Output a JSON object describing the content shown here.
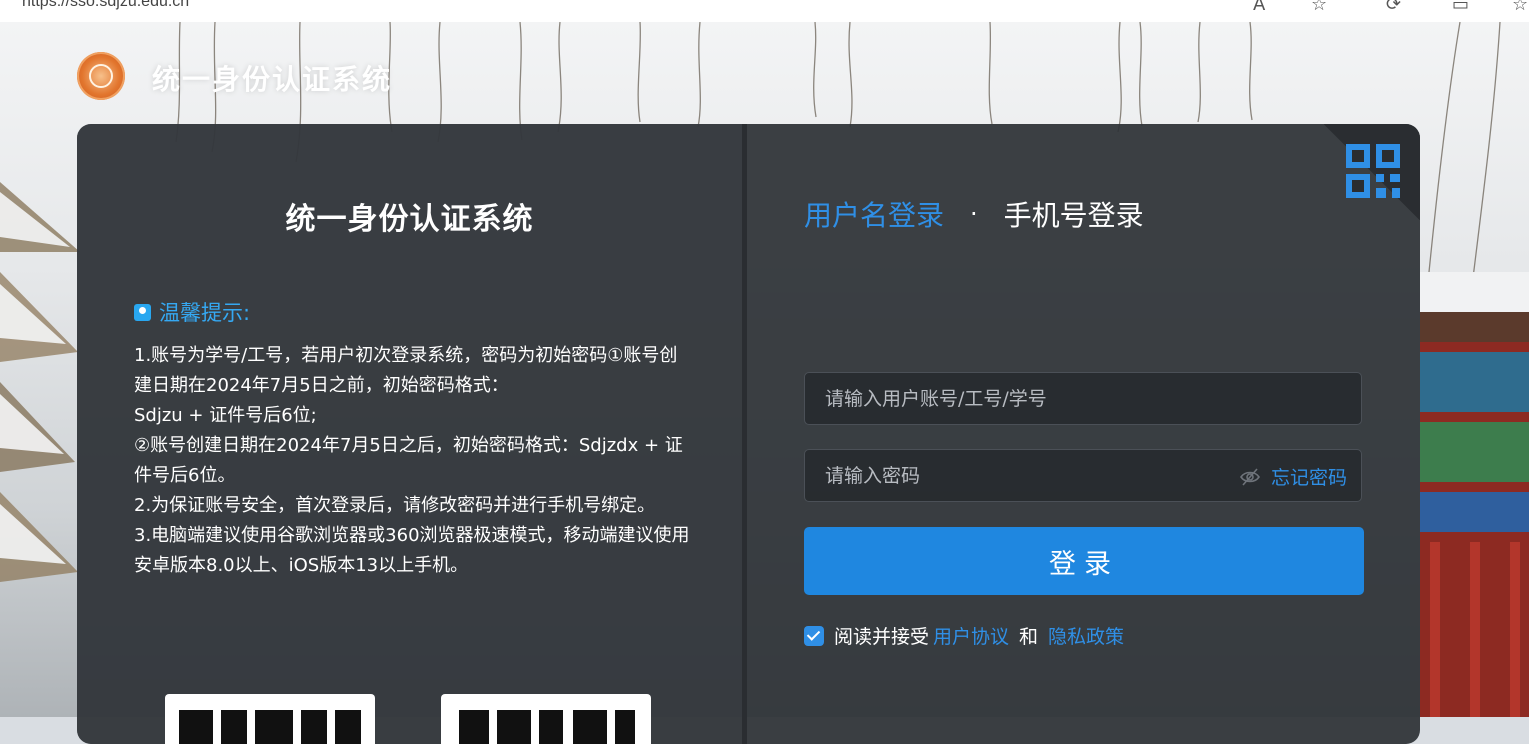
{
  "browser": {
    "url": "https://sso.sdjzu.edu.cn"
  },
  "header": {
    "title": "统一身份认证系统"
  },
  "left": {
    "title": "统一身份认证系统",
    "tips_title": "温馨提示:",
    "tips": [
      "1.账号为学号/工号，若用户初次登录系统，密码为初始密码①账号创建日期在2024年7月5日之前，初始密码格式：",
      "Sdjzu + 证件号后6位;",
      "②账号创建日期在2024年7月5日之后，初始密码格式：Sdjzdx + 证件号后6位。",
      "2.为保证账号安全，首次登录后，请修改密码并进行手机号绑定。",
      "3.电脑端建议使用谷歌浏览器或360浏览器极速模式，移动端建议使用安卓版本8.0以上、iOS版本13以上手机。"
    ]
  },
  "tabs": {
    "username_login": "用户名登录",
    "separator": "·",
    "phone_login": "手机号登录"
  },
  "form": {
    "username_placeholder": "请输入用户账号/工号/学号",
    "password_placeholder": "请输入密码",
    "forgot_password": "忘记密码",
    "login_button": "登录",
    "agree_prefix": "阅读并接受",
    "user_agreement": "用户协议",
    "and": "和",
    "privacy_policy": "隐私政策"
  },
  "colors": {
    "accent": "#1f87e0",
    "link": "#2f8fe6",
    "tips": "#35a8f2",
    "card": "#2d3136"
  },
  "icons": [
    "logo-emblem",
    "qr-code-icon",
    "tips-icon",
    "eye-slash-icon",
    "checkbox-checked-icon"
  ]
}
